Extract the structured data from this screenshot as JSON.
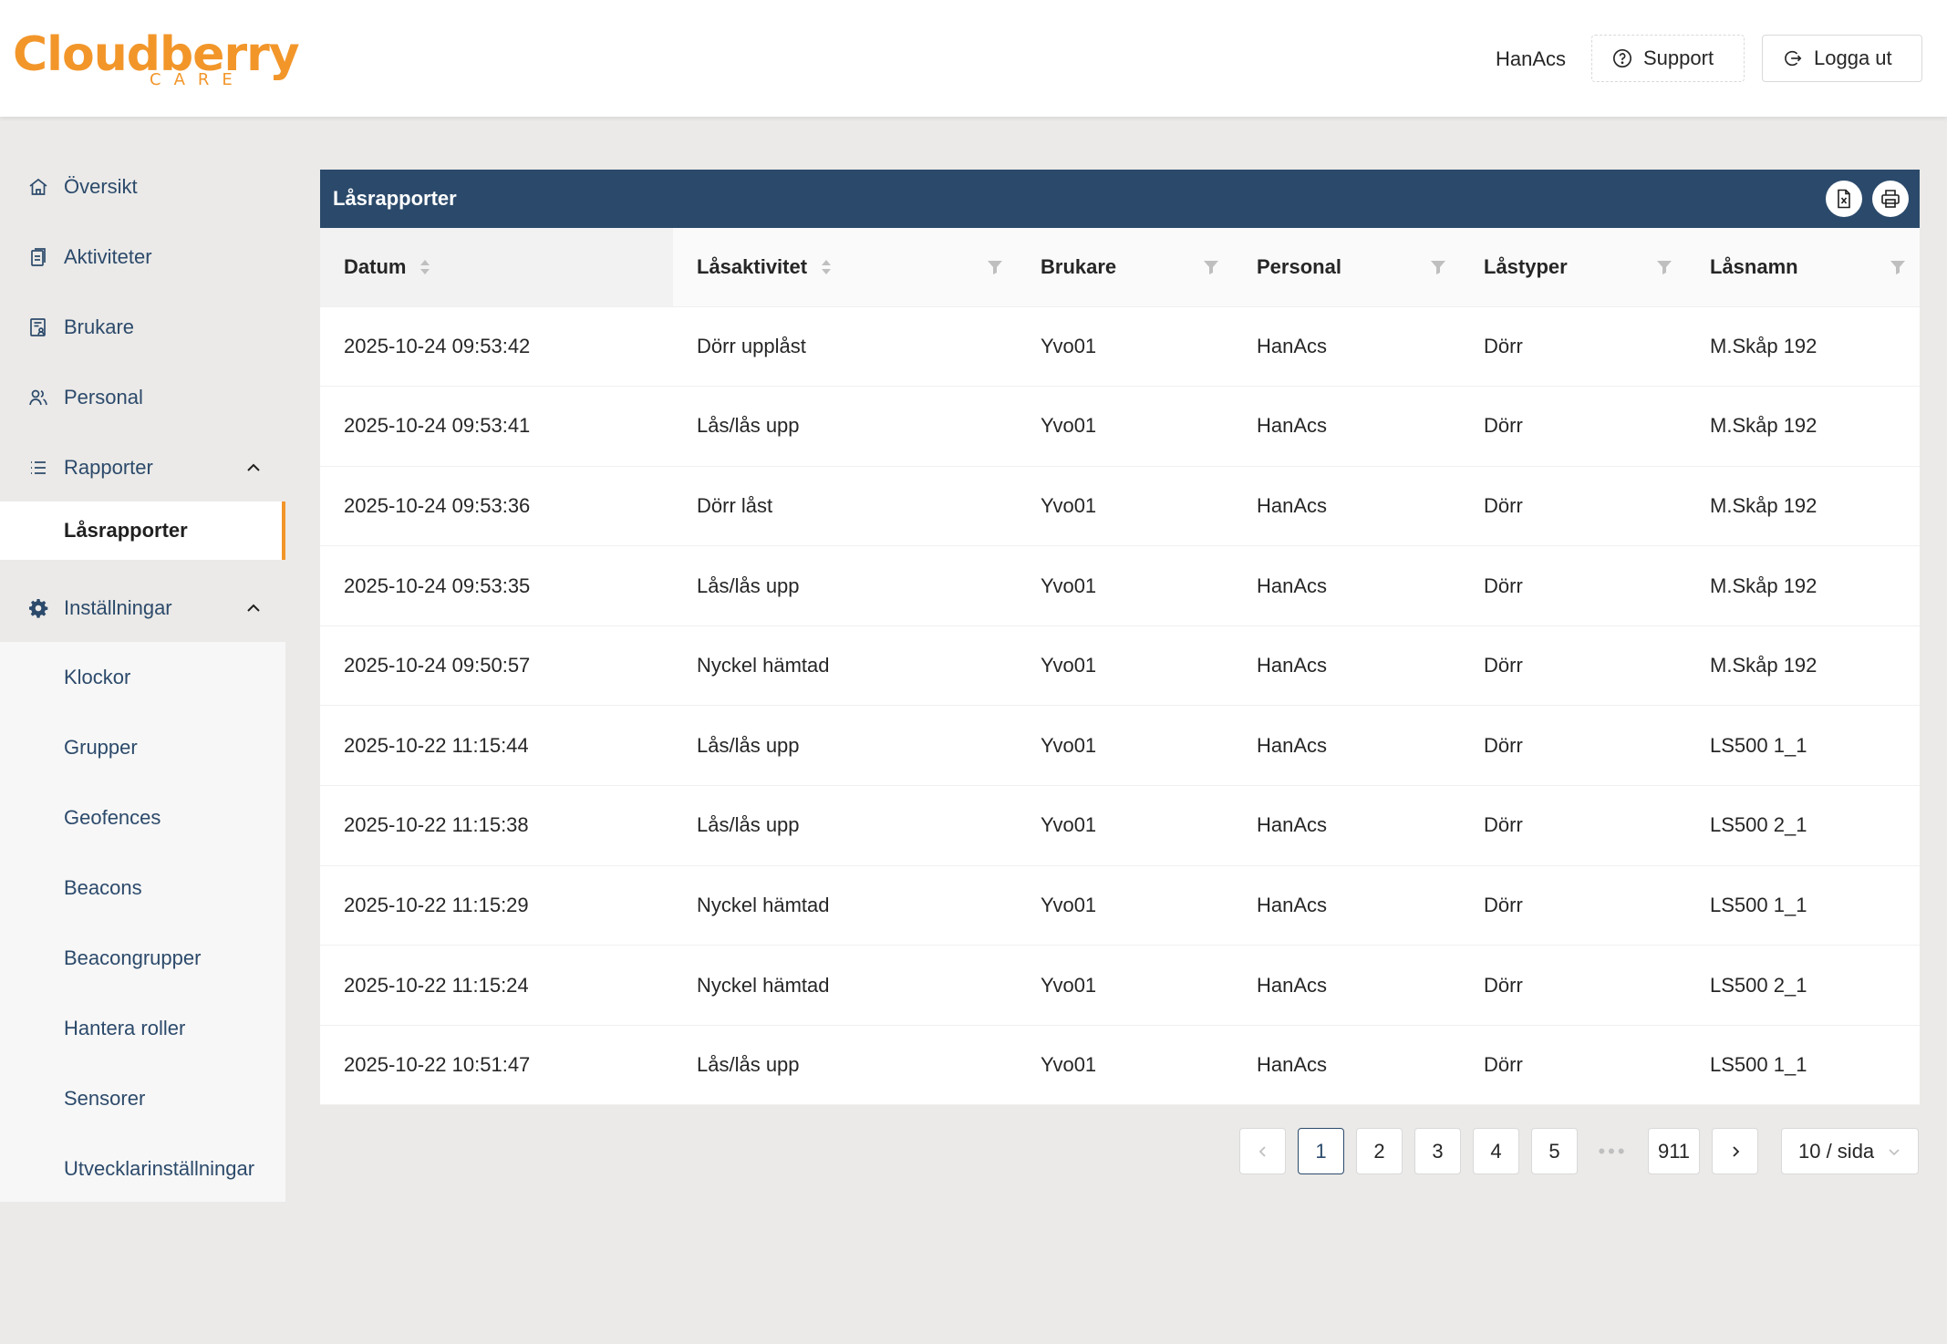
{
  "header": {
    "logo_text": "Cloudberry",
    "logo_sub": "CARE",
    "user": "HanAcs",
    "support_label": "Support",
    "logout_label": "Logga ut"
  },
  "sidebar": {
    "items": [
      {
        "label": "Översikt",
        "icon": "home-icon"
      },
      {
        "label": "Aktiviteter",
        "icon": "clipboard-icon"
      },
      {
        "label": "Brukare",
        "icon": "user-card-icon"
      },
      {
        "label": "Personal",
        "icon": "users-icon"
      },
      {
        "label": "Rapporter",
        "icon": "list-icon"
      },
      {
        "label": "Inställningar",
        "icon": "gear-icon"
      }
    ],
    "rapporter_sub": [
      "Låsrapporter"
    ],
    "installningar_sub": [
      "Klockor",
      "Grupper",
      "Geofences",
      "Beacons",
      "Beacongrupper",
      "Hantera roller",
      "Sensorer",
      "Utvecklarinställningar"
    ]
  },
  "panel": {
    "title": "Låsrapporter",
    "columns": [
      "Datum",
      "Låsaktivitet",
      "Brukare",
      "Personal",
      "Låstyper",
      "Låsnamn"
    ],
    "rows": [
      [
        "2025-10-24 09:53:42",
        "Dörr upplåst",
        "Yvo01",
        "HanAcs",
        "Dörr",
        "M.Skåp 192"
      ],
      [
        "2025-10-24 09:53:41",
        "Lås/lås upp",
        "Yvo01",
        "HanAcs",
        "Dörr",
        "M.Skåp 192"
      ],
      [
        "2025-10-24 09:53:36",
        "Dörr låst",
        "Yvo01",
        "HanAcs",
        "Dörr",
        "M.Skåp 192"
      ],
      [
        "2025-10-24 09:53:35",
        "Lås/lås upp",
        "Yvo01",
        "HanAcs",
        "Dörr",
        "M.Skåp 192"
      ],
      [
        "2025-10-24 09:50:57",
        "Nyckel hämtad",
        "Yvo01",
        "HanAcs",
        "Dörr",
        "M.Skåp 192"
      ],
      [
        "2025-10-22 11:15:44",
        "Lås/lås upp",
        "Yvo01",
        "HanAcs",
        "Dörr",
        "LS500 1_1"
      ],
      [
        "2025-10-22 11:15:38",
        "Lås/lås upp",
        "Yvo01",
        "HanAcs",
        "Dörr",
        "LS500 2_1"
      ],
      [
        "2025-10-22 11:15:29",
        "Nyckel hämtad",
        "Yvo01",
        "HanAcs",
        "Dörr",
        "LS500 1_1"
      ],
      [
        "2025-10-22 11:15:24",
        "Nyckel hämtad",
        "Yvo01",
        "HanAcs",
        "Dörr",
        "LS500 2_1"
      ],
      [
        "2025-10-22 10:51:47",
        "Lås/lås upp",
        "Yvo01",
        "HanAcs",
        "Dörr",
        "LS500 1_1"
      ]
    ]
  },
  "pagination": {
    "pages": [
      "1",
      "2",
      "3",
      "4",
      "5"
    ],
    "jump": "•••",
    "last": "911",
    "page_size": "10 / sida"
  },
  "colors": {
    "brand": "#f2962a",
    "panel_header": "#2b4a6b",
    "nav_text": "#2c4a6b",
    "background": "#ebeae8"
  }
}
